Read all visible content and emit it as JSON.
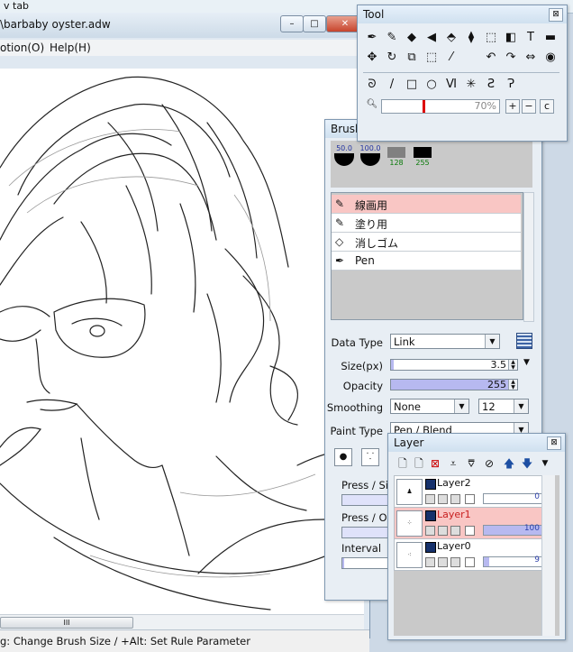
{
  "browser_tab": {
    "label": "v tab"
  },
  "window": {
    "title": "\\barbaby oyster.adw",
    "minimize_label": "–",
    "maximize_label": "□",
    "close_label": "✕"
  },
  "menu": {
    "items": [
      "otion(O)",
      "Help(H)"
    ]
  },
  "scrollbar": {
    "grip": "III"
  },
  "status": {
    "text": "g: Change Brush Size / +Alt: Set Rule Parameter"
  },
  "tool_panel": {
    "title": "Tool",
    "close": "⊠",
    "zoom_value": "70%",
    "zoom_plus": "+",
    "zoom_minus": "−",
    "zoom_reset": "c",
    "icons": [
      "pen-icon",
      "brush-icon",
      "eraser-icon",
      "bucket-icon",
      "stamp-icon",
      "fill-icon",
      "select-icon",
      "gradient-icon",
      "text-icon",
      "ruler-icon",
      "move-icon",
      "rotate-icon",
      "crop-icon",
      "marquee-icon",
      "eyedropper-icon",
      "undo-icon",
      "redo-icon",
      "flip-icon",
      "record-icon",
      "lasso-icon",
      "line-icon",
      "rect-icon",
      "ellipse-icon",
      "polyline-icon",
      "star-icon",
      "curve-icon",
      "bezier-icon"
    ]
  },
  "brush_panel": {
    "title": "Brush",
    "close": "⊠",
    "presets": [
      {
        "value": "50.0",
        "kind": "black-circle"
      },
      {
        "value": "100.0",
        "kind": "black-circle"
      },
      {
        "value": "128",
        "kind": "gray-swatch"
      },
      {
        "value": "255",
        "kind": "black-swatch"
      }
    ],
    "brushes": [
      {
        "label": "線画用",
        "selected": true
      },
      {
        "label": "塗り用",
        "selected": false
      },
      {
        "label": "消しゴム",
        "selected": false
      },
      {
        "label": "Pen",
        "selected": false
      }
    ],
    "data_type_label": "Data Type",
    "data_type_value": "Link",
    "size_label": "Size(px)",
    "size_value": "3.5",
    "opacity_label": "Opacity",
    "opacity_value": "255",
    "opacity_level": 1.0,
    "size_level": 0.02,
    "smoothing_label": "Smoothing",
    "smoothing_value": "None",
    "smoothing_num": "12",
    "paint_type_label": "Paint Type",
    "paint_type_value": "Pen / Blend",
    "press_size_label": "Press / Size",
    "press_op_label": "Press / Op",
    "interval_label": "Interval"
  },
  "layer_panel": {
    "title": "Layer",
    "close": "⊠",
    "layers": [
      {
        "name": "Layer2",
        "opacity": "0",
        "level": 0.0,
        "selected": false
      },
      {
        "name": "Layer1",
        "opacity": "100",
        "level": 1.0,
        "selected": true
      },
      {
        "name": "Layer0",
        "opacity": "9",
        "level": 0.09,
        "selected": false
      }
    ]
  },
  "colors": {
    "selection_pink": "#f9c6c4",
    "slider_fill": "#b7b9f0",
    "title_gradient": "#cfe0ef",
    "layer_blue": "#16316b"
  }
}
